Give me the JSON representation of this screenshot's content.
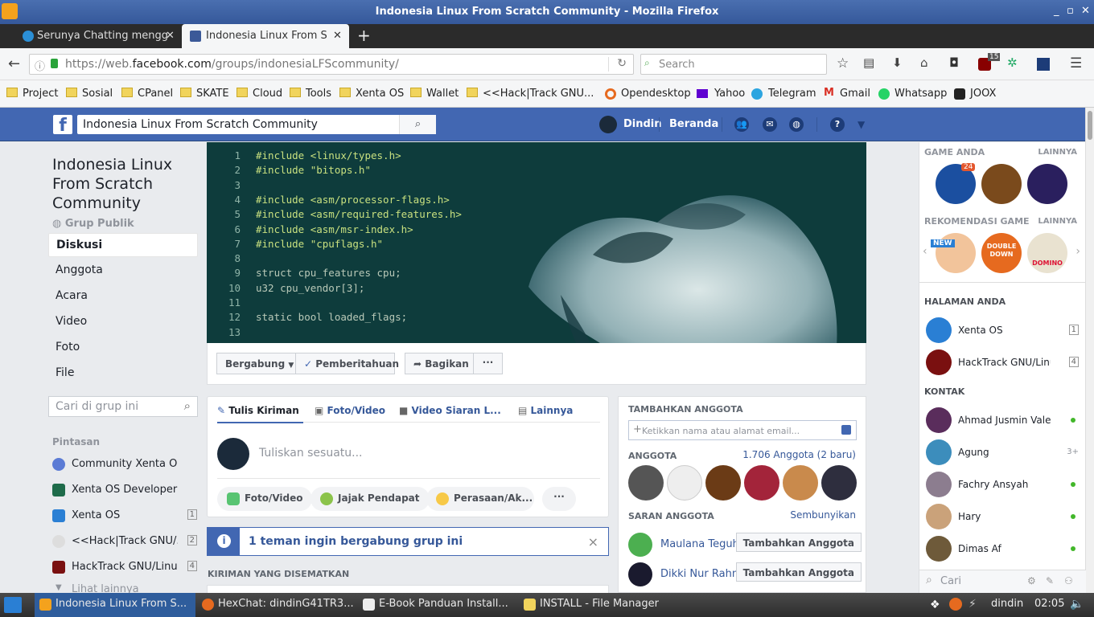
{
  "window": {
    "title": "Indonesia Linux From Scratch Community - Mozilla Firefox",
    "controls": [
      "_",
      "▫",
      "✕"
    ]
  },
  "tabs": [
    {
      "label": "Serunya Chatting mengg",
      "active": false
    },
    {
      "label": "Indonesia Linux From S",
      "active": true
    }
  ],
  "nav": {
    "url_prefix": "https://web.",
    "url_domain": "facebook.com",
    "url_path": "/groups/indonesiaLFScommunity/",
    "search_placeholder": "Search",
    "ublock_count": "15"
  },
  "bookmarks": [
    "Project",
    "Sosial",
    "CPanel",
    "SKATE",
    "Cloud",
    "Tools",
    "Xenta OS",
    "Wallet",
    "<<Hack|Track GNU...",
    "Opendesktop",
    "Yahoo",
    "Telegram",
    "Gmail",
    "Whatsapp",
    "JOOX"
  ],
  "fbbar": {
    "search_value": "Indonesia Linux From Scratch Community",
    "user_name": "Dindin",
    "home_label": "Beranda"
  },
  "group": {
    "name": "Indonesia Linux From Scratch Community",
    "type": "Grup Publik",
    "nav": [
      "Diskusi",
      "Anggota",
      "Acara",
      "Video",
      "Foto",
      "File"
    ],
    "search_placeholder": "Cari di grup ini",
    "shortcuts_title": "Pintasan",
    "shortcuts": [
      {
        "label": "Community Xenta OS",
        "count": ""
      },
      {
        "label": "Xenta OS Developer",
        "count": ""
      },
      {
        "label": "Xenta OS",
        "count": "1"
      },
      {
        "label": "<<Hack|Track GNU/...",
        "count": "2"
      },
      {
        "label": "HackTrack GNU/Linux",
        "count": "4"
      },
      {
        "label": "Lihat lainnya",
        "count": ""
      }
    ]
  },
  "cover_code": [
    {
      "n": "1",
      "t": "#include <linux/types.h>"
    },
    {
      "n": "2",
      "t": "#include \"bitops.h\""
    },
    {
      "n": "3",
      "t": ""
    },
    {
      "n": "4",
      "t": "#include <asm/processor-flags.h>"
    },
    {
      "n": "5",
      "t": "#include <asm/required-features.h>"
    },
    {
      "n": "6",
      "t": "#include <asm/msr-index.h>"
    },
    {
      "n": "7",
      "t": "#include \"cpuflags.h\""
    },
    {
      "n": "8",
      "t": ""
    },
    {
      "n": "9",
      "t": "struct cpu_features cpu;"
    },
    {
      "n": "10",
      "t": "u32 cpu_vendor[3];"
    },
    {
      "n": "11",
      "t": ""
    },
    {
      "n": "12",
      "t": "static bool loaded_flags;"
    },
    {
      "n": "13",
      "t": ""
    }
  ],
  "cover_actions": {
    "join": "Bergabung",
    "notify": "Pemberitahuan",
    "share": "Bagikan",
    "more": "···"
  },
  "composer": {
    "tabs": [
      "Tulis Kiriman",
      "Foto/Video",
      "Video Siaran L...",
      "Lainnya"
    ],
    "placeholder": "Tuliskan sesuatu...",
    "pills": [
      "Foto/Video",
      "Jajak Pendapat",
      "Perasaan/Ak...",
      "···"
    ]
  },
  "notice": {
    "text": "1 teman ingin bergabung grup ini",
    "close": "×"
  },
  "pinned_title": "KIRIMAN YANG DISEMATKAN",
  "members_panel": {
    "add_title": "TAMBAHKAN ANGGOTA",
    "add_placeholder": "Ketikkan nama atau alamat email...",
    "members_title": "ANGGOTA",
    "members_count": "1.706 Anggota (2 baru)",
    "suggest_title": "SARAN ANGGOTA",
    "hide_label": "Sembunyikan",
    "suggestions": [
      {
        "name": "Maulana Teguh S",
        "button": "Tambahkan Anggota"
      },
      {
        "name": "Dikki Nur Rahmat",
        "button": "Tambahkan Anggota"
      }
    ]
  },
  "sidebar": {
    "games_title": "GAME ANDA",
    "games_more": "LAINNYA",
    "games_badge": "24",
    "rec_title": "REKOMENDASI GAME",
    "rec_more": "LAINNYA",
    "rec_labels": [
      "NEW",
      "DOUBLE DOWN",
      "DOMINO"
    ],
    "pages_title": "HALAMAN ANDA",
    "pages": [
      {
        "name": "Xenta OS",
        "count": "1"
      },
      {
        "name": "HackTrack GNU/Linux",
        "count": "4"
      }
    ],
    "contacts_title": "KONTAK",
    "contacts": [
      {
        "name": "Ahmad Jusmin Vale...",
        "status": "online"
      },
      {
        "name": "Agung",
        "status": "3+"
      },
      {
        "name": "Fachry Ansyah",
        "status": "online"
      },
      {
        "name": "Hary",
        "status": "online"
      },
      {
        "name": "Dimas Af",
        "status": "online"
      }
    ],
    "chat_search_placeholder": "Cari"
  },
  "taskbar": {
    "items": [
      {
        "label": "Indonesia Linux From S...",
        "active": true
      },
      {
        "label": "HexChat: dindinG41TR3...",
        "active": false
      },
      {
        "label": "E-Book Panduan Install...",
        "active": false
      },
      {
        "label": "INSTALL - File Manager",
        "active": false
      }
    ],
    "user": "dindin",
    "time": "02:05"
  },
  "colors": {
    "fb_blue": "#4267b2",
    "link": "#365899",
    "online": "#42b72a"
  }
}
